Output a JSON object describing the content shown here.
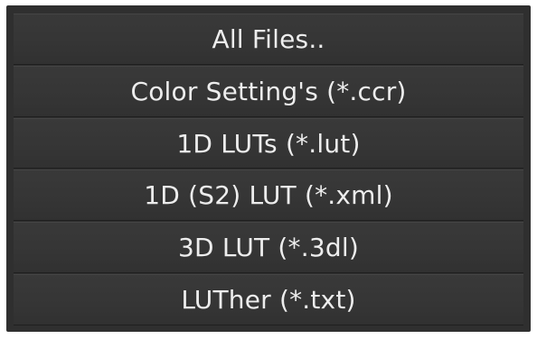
{
  "file_type_menu": {
    "items": [
      {
        "label": "All Files.."
      },
      {
        "label": "Color Setting's (*.ccr)"
      },
      {
        "label": "1D LUTs (*.lut)"
      },
      {
        "label": "1D (S2) LUT (*.xml)"
      },
      {
        "label": "3D LUT (*.3dl)"
      },
      {
        "label": "LUTher (*.txt)"
      }
    ]
  }
}
